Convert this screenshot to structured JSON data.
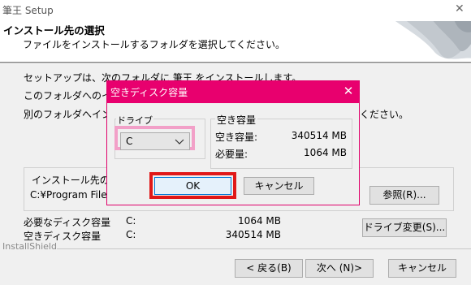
{
  "window": {
    "title": "筆王 Setup",
    "close_icon": "close-icon"
  },
  "header": {
    "title": "インストール先の選択",
    "subtitle": "ファイルをインストールするフォルダを選択してください。"
  },
  "body": {
    "line1": "セットアップは、次のフォルダに 筆王 をインストールします。",
    "line2": "このフォルダへのイ",
    "line3a": "別のフォルダへイン",
    "line3b": "ください。"
  },
  "destination": {
    "group_label": "インストール先のフ",
    "path": "C:¥Program Files",
    "browse_label": "参照(R)..."
  },
  "disk": {
    "required_label": "必要なディスク容量",
    "required_drive": "C:",
    "required_value": "1064 MB",
    "free_label": "空きディスク容量",
    "free_drive": "C:",
    "free_value": "340514 MB",
    "change_drive_label": "ドライブ変更(S)..."
  },
  "footer": {
    "installshield": "InstallShield",
    "back_label": "< 戻る(B)",
    "next_label": "次へ (N)>",
    "cancel_label": "キャンセル"
  },
  "modal": {
    "title": "空きディスク容量",
    "drive_group_label": "ドライブ",
    "drive_value": "C",
    "space_group_label": "空き容量",
    "free_label": "空き容量:",
    "free_value": "340514 MB",
    "required_label": "必要量:",
    "required_value": "1064 MB",
    "ok_label": "OK",
    "cancel_label": "キャンセル"
  },
  "colors": {
    "modal_accent": "#e8006e",
    "highlight_pink": "#f2a0c8",
    "highlight_red": "#e01818"
  }
}
